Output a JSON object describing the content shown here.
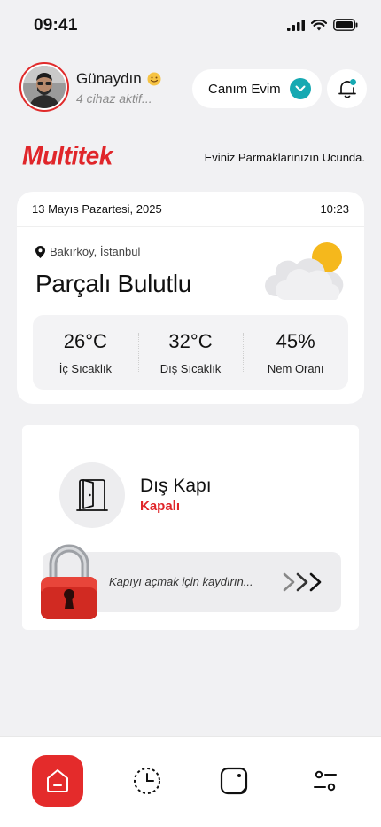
{
  "status": {
    "time": "09:41"
  },
  "header": {
    "greeting": "Günaydın",
    "subtitle": "4 cihaz aktif...",
    "home_selector": "Canım Evim"
  },
  "brand": {
    "logo_text": "Multitek",
    "tagline": "Eviniz Parmaklarınızın Ucunda."
  },
  "weather": {
    "date": "13 Mayıs Pazartesi, 2025",
    "time": "10:23",
    "location": "Bakırköy, İstanbul",
    "condition": "Parçalı Bulutlu",
    "stats": [
      {
        "value": "26°C",
        "label": "İç Sıcaklık"
      },
      {
        "value": "32°C",
        "label": "Dış Sıcaklık"
      },
      {
        "value": "45%",
        "label": "Nem Oranı"
      }
    ]
  },
  "door": {
    "title": "Dış Kapı",
    "status": "Kapalı",
    "slider_hint": "Kapıyı açmak için kaydırın..."
  },
  "colors": {
    "accent_red": "#e42b2b",
    "teal": "#16a9b2",
    "background": "#f1f1f3"
  },
  "icons": [
    "signal-icon",
    "wifi-icon",
    "battery-icon",
    "chevron-down-icon",
    "bell-icon",
    "location-pin-icon",
    "partly-cloudy-icon",
    "door-icon",
    "padlock-icon",
    "arrows-right-icon",
    "home-icon",
    "history-icon",
    "device-icon",
    "settings-sliders-icon"
  ]
}
